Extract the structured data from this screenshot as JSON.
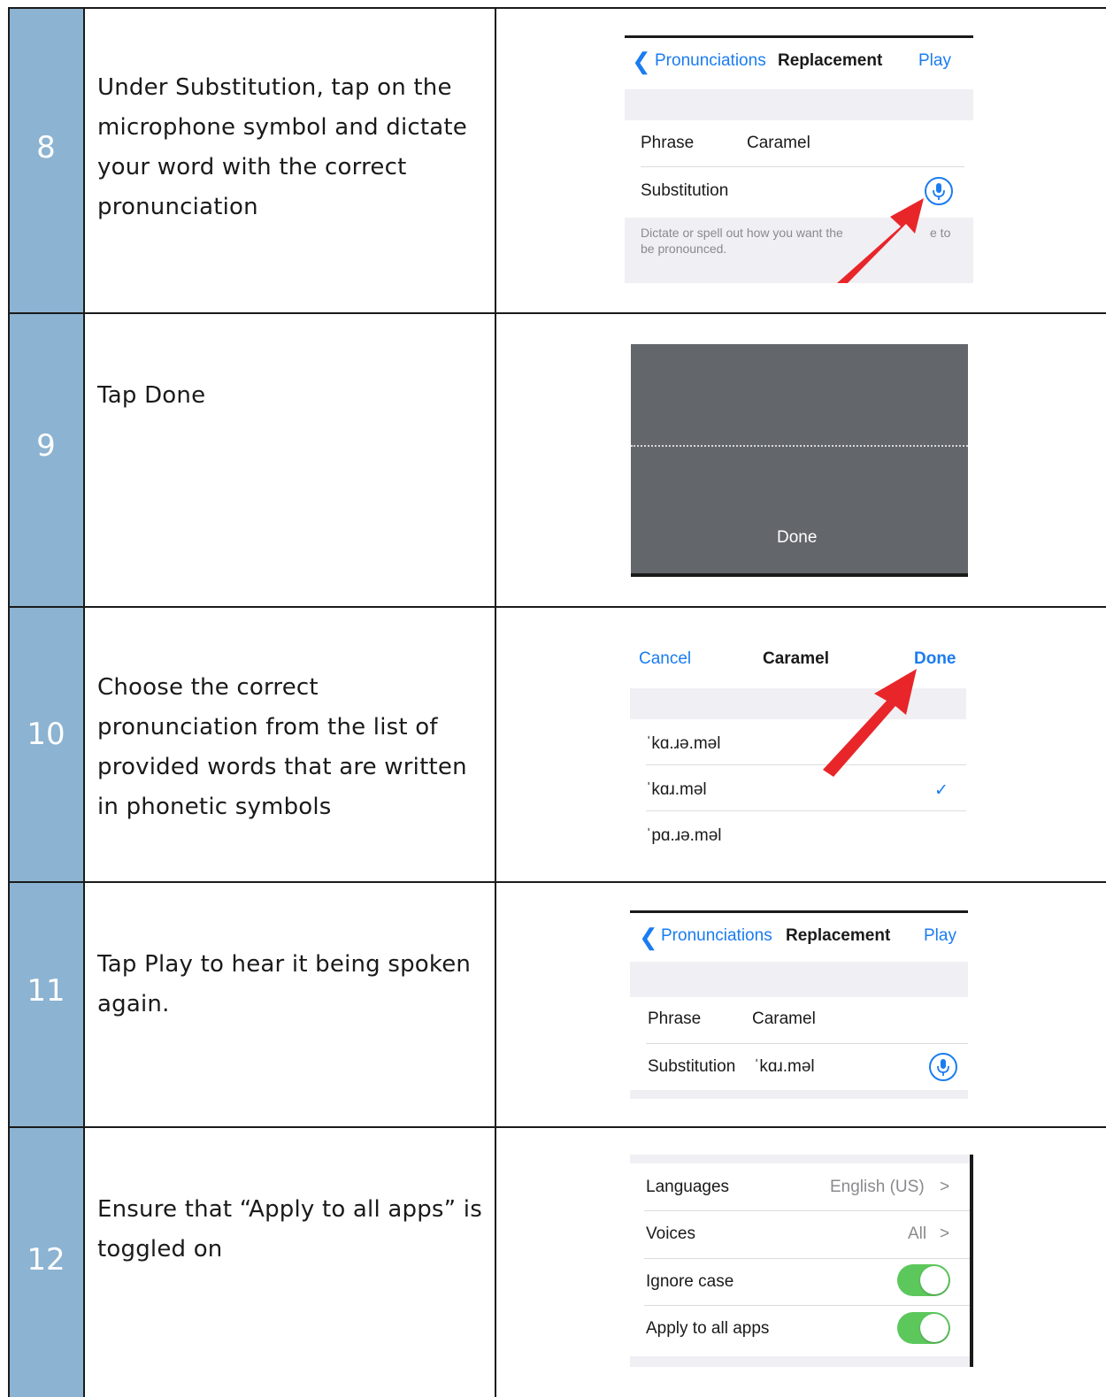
{
  "colors": {
    "number_column": "#8cb3d1",
    "ios_blue": "#1a7cf0",
    "arrow_red": "#e8262a",
    "toggle_green": "#5cc85c"
  },
  "steps": [
    {
      "number": "8",
      "instruction": "Under Substitution, tap on the microphone symbol and dictate your word with the correct pronunciation",
      "screen": {
        "back_label": "Pronunciations",
        "title": "Replacement",
        "action": "Play",
        "phrase_label": "Phrase",
        "phrase_value": "Caramel",
        "substitution_label": "Substitution",
        "hint_line1": "Dictate or spell out how you want the",
        "hint_line1_end": "e to",
        "hint_line2": "be pronounced.",
        "mic_icon": "microphone-icon"
      }
    },
    {
      "number": "9",
      "instruction": "Tap Done",
      "screen": {
        "done_label": "Done"
      }
    },
    {
      "number": "10",
      "instruction": "Choose the correct pronunciation from the list of provided words that are written in phonetic symbols",
      "screen": {
        "cancel_label": "Cancel",
        "title": "Caramel",
        "done_label": "Done",
        "options": [
          "ˈkɑ.ɹə.məl",
          "ˈkɑɹ.məl",
          "ˈpɑ.ɹə.məl"
        ],
        "checkmark": "✓"
      }
    },
    {
      "number": "11",
      "instruction": "Tap Play to hear it being spoken again.",
      "screen": {
        "back_label": "Pronunciations",
        "title": "Replacement",
        "action": "Play",
        "phrase_label": "Phrase",
        "phrase_value": "Caramel",
        "substitution_label": "Substitution",
        "substitution_value": "ˈkɑɹ.məl",
        "mic_icon": "microphone-icon"
      }
    },
    {
      "number": "12",
      "instruction": "Ensure that “Apply to all apps” is toggled on",
      "screen": {
        "languages_label": "Languages",
        "languages_value": "English (US)",
        "voices_label": "Voices",
        "voices_value": "All",
        "chevron": ">",
        "ignore_case_label": "Ignore case",
        "ignore_case_on": true,
        "apply_all_label": "Apply to all apps",
        "apply_all_on": true
      }
    }
  ]
}
